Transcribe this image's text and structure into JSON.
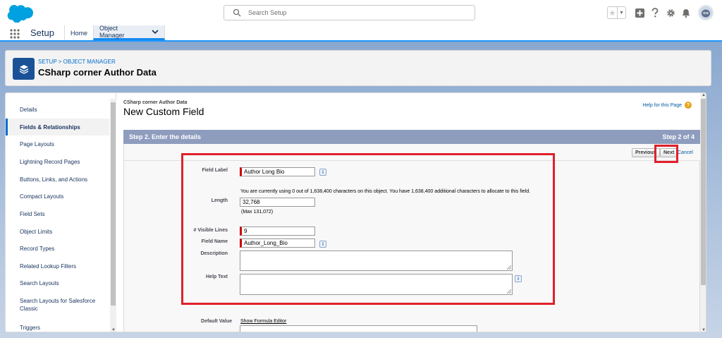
{
  "header": {
    "search_placeholder": "Search Setup"
  },
  "context_bar": {
    "app_name": "Setup",
    "tabs": [
      {
        "label": "Home"
      },
      {
        "label": "Object Manager"
      }
    ]
  },
  "object_header": {
    "breadcrumb": "SETUP > OBJECT MANAGER",
    "title": "CSharp corner Author Data"
  },
  "sidebar": {
    "items": [
      {
        "label": "Details"
      },
      {
        "label": "Fields & Relationships",
        "active": true
      },
      {
        "label": "Page Layouts"
      },
      {
        "label": "Lightning Record Pages"
      },
      {
        "label": "Buttons, Links, and Actions"
      },
      {
        "label": "Compact Layouts"
      },
      {
        "label": "Field Sets"
      },
      {
        "label": "Object Limits"
      },
      {
        "label": "Record Types"
      },
      {
        "label": "Related Lookup Filters"
      },
      {
        "label": "Search Layouts"
      },
      {
        "label": "Search Layouts for Salesforce Classic"
      },
      {
        "label": "Triggers"
      }
    ]
  },
  "page": {
    "object_name": "CSharp corner Author Data",
    "title": "New Custom Field",
    "help_link": "Help for this Page",
    "step_title": "Step 2. Enter the details",
    "step_count": "Step 2 of 4",
    "buttons": {
      "previous": "Previous",
      "next": "Next",
      "cancel": "Cancel"
    }
  },
  "form": {
    "field_label": {
      "label": "Field Label",
      "value": "Author Long Bio"
    },
    "length": {
      "label": "Length",
      "usage_note": "You are currently using 0 out of 1,638,400 characters on this object. You have 1,638,400 additional characters to allocate to this field.",
      "value": "32,768",
      "max_note": "(Max 131,072)"
    },
    "visible_lines": {
      "label": "# Visible Lines",
      "value": "9"
    },
    "field_name": {
      "label": "Field Name",
      "value": "Author_Long_Bio"
    },
    "description": {
      "label": "Description",
      "value": ""
    },
    "help_text": {
      "label": "Help Text",
      "value": ""
    },
    "default_value": {
      "label": "Default Value",
      "link": "Show Formula Editor"
    }
  },
  "colors": {
    "brand": "#1b96ff",
    "highlight": "#e0202c",
    "step_bar": "#8e9dbe"
  }
}
